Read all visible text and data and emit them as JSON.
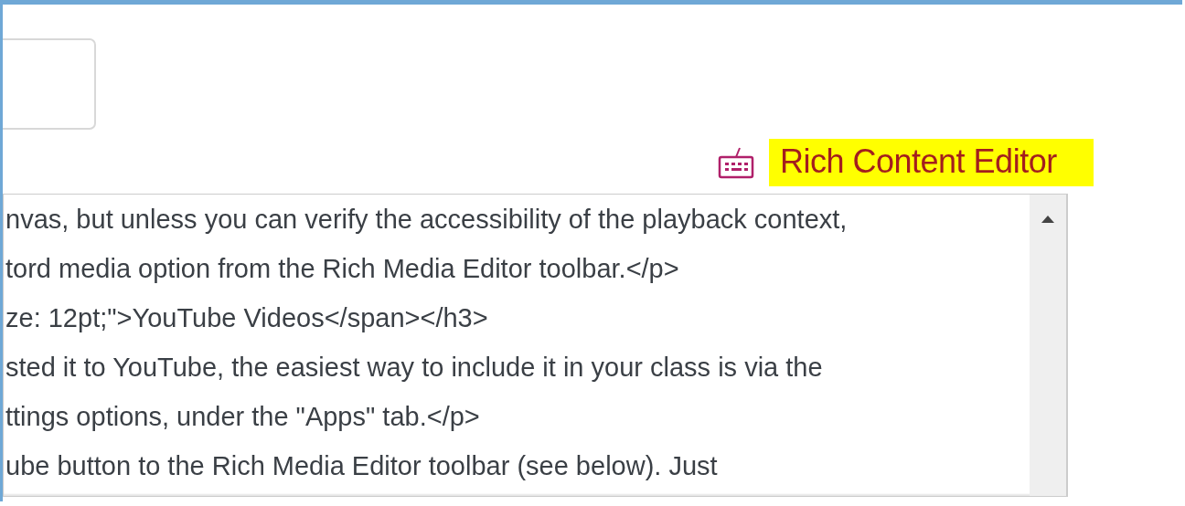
{
  "editor_switch": {
    "label": "Rich Content Editor"
  },
  "html_editor": {
    "lines": [
      "nvas, but unless you can verify the accessibility of the playback context,",
      "tord media option from the Rich Media Editor toolbar.</p>",
      "ze: 12pt;\">YouTube Videos</span></h3>",
      "sted it to YouTube, the easiest way to include it in your class is via the",
      "ttings options, under the \"Apps\" tab.</p>",
      "ube button to the Rich Media Editor toolbar (see below). Just"
    ]
  }
}
